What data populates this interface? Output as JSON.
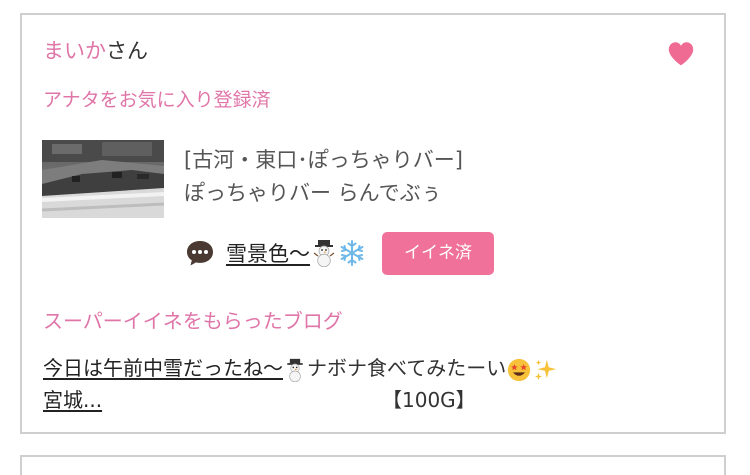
{
  "user": {
    "name": "まいか",
    "suffix": "さん"
  },
  "favorite_status": "アナタをお気に入り登録済",
  "shop": {
    "area": "[古河・東口･ぽっちゃりバー]",
    "name": "ぽっちゃりバー らんでぶぅ"
  },
  "post": {
    "title": "雪景色〜",
    "like_status": "イイネ済"
  },
  "super_like": {
    "heading": "スーパーイイネをもらったブログ",
    "blog_title_part1": "今日は午前中雪だったね〜",
    "blog_title_part2": "ナボナ食べてみたーい",
    "blog_title_part3": "宮城...",
    "points": "【100G】"
  },
  "colors": {
    "accent_pink": "#e075a8",
    "badge_pink": "#f0729a",
    "heart_pink": "#f06b94",
    "border": "#cfcfcf"
  },
  "icons": [
    "heart-icon",
    "speech-bubble-icon",
    "snowman-icon",
    "snowflake-icon",
    "star-struck-icon",
    "sparkles-icon"
  ]
}
